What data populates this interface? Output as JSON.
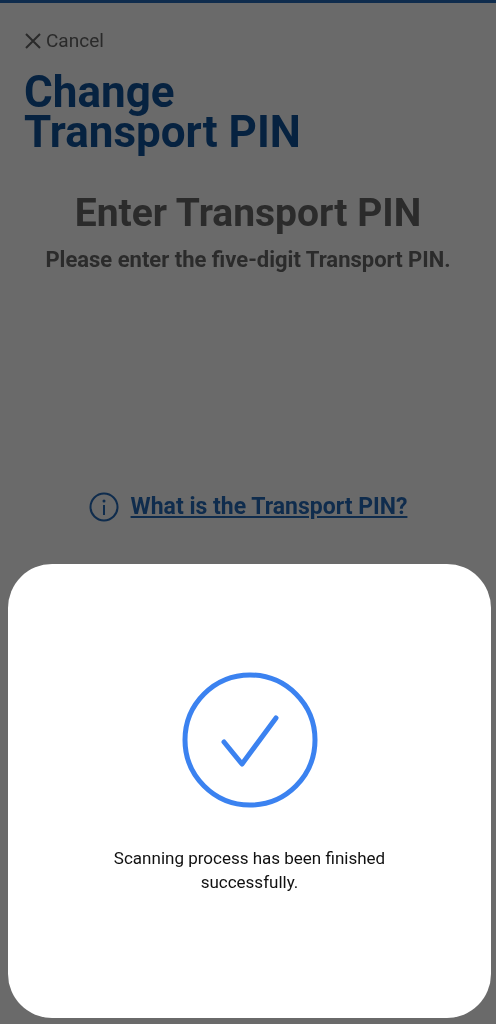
{
  "cancel": {
    "label": "Cancel"
  },
  "title": "Change Transport PIN",
  "heading": "Enter Transport PIN",
  "description": "Please enter the five-digit Transport PIN.",
  "info_link": "What is the Transport PIN?",
  "sheet": {
    "kind": "success",
    "message": "Scanning process has been finished successfully."
  }
}
